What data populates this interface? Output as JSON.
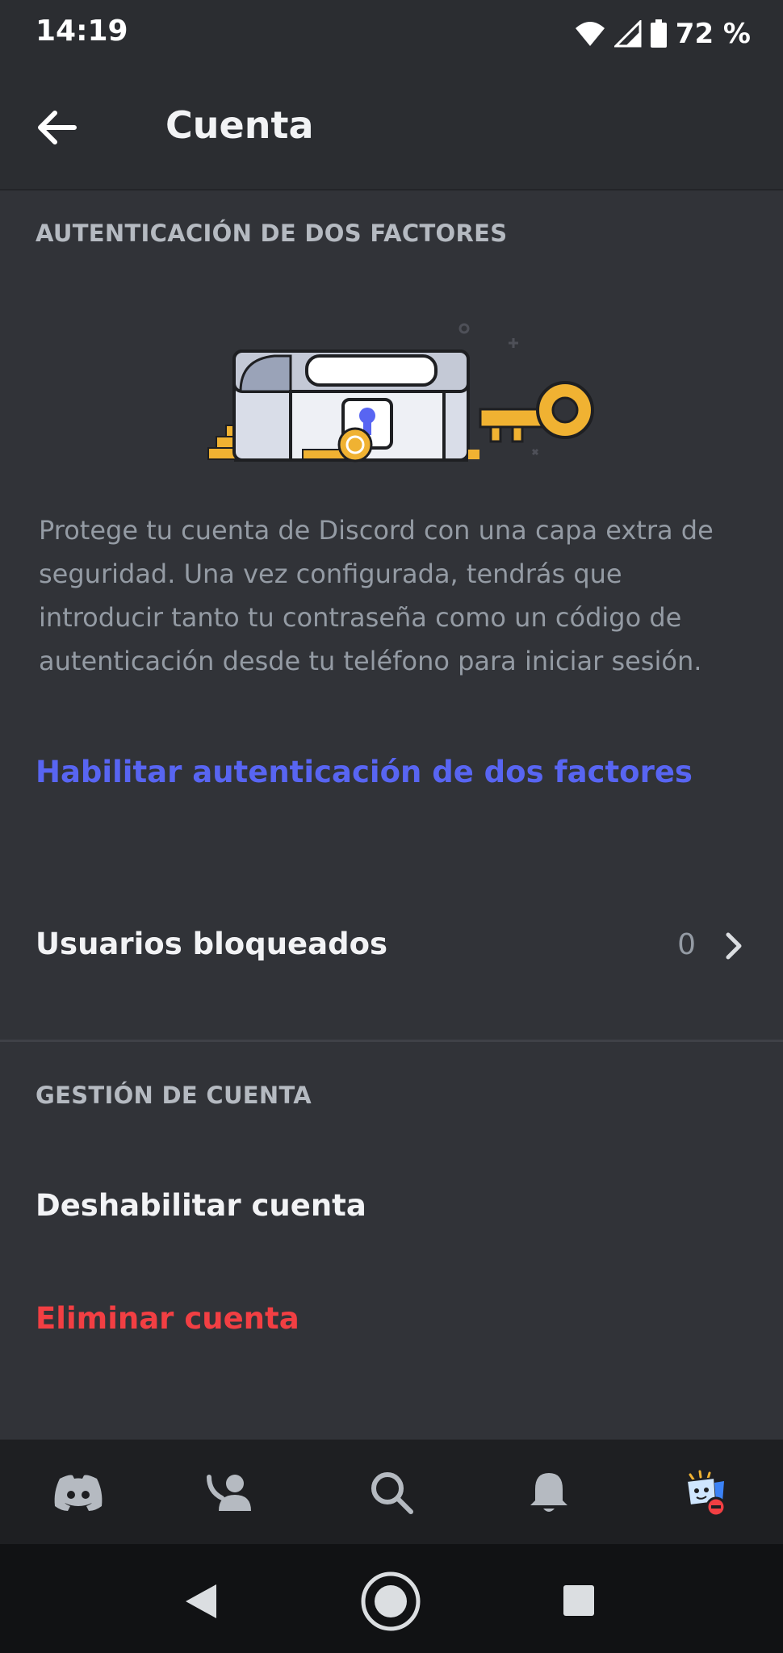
{
  "status_bar": {
    "time": "14:19",
    "battery": "72 %",
    "icons": [
      "wifi-icon",
      "signal-icon",
      "battery-icon"
    ]
  },
  "header": {
    "title": "Cuenta",
    "back_icon": "arrow-left-icon"
  },
  "two_factor": {
    "section_title": "AUTENTICACIÓN DE DOS FACTORES",
    "illustration": "treasure-chest-key-illustration",
    "description": "Protege tu cuenta de Discord con una capa extra de seguridad. Una vez configurada, tendrás que introducir tanto tu contraseña como un código de autenticación desde tu teléfono para iniciar sesión.",
    "enable_link": "Habilitar autenticación de dos factores"
  },
  "blocked_users": {
    "label": "Usuarios bloqueados",
    "count": "0",
    "chevron_icon": "chevron-right-icon"
  },
  "account_management": {
    "section_title": "GESTIÓN DE CUENTA",
    "disable_label": "Deshabilitar cuenta",
    "delete_label": "Eliminar cuenta"
  },
  "bottom_nav": {
    "items": [
      "discord-home-icon",
      "friends-icon",
      "search-icon",
      "notifications-bell-icon",
      "profile-avatar-icon"
    ]
  },
  "system_nav": [
    "back-triangle-icon",
    "home-circle-icon",
    "recents-square-icon"
  ],
  "colors": {
    "background": "#313338",
    "header": "#2b2d31",
    "link": "#5865f2",
    "danger": "#f23f43",
    "muted": "#949ba4",
    "nav": "#1e1f22"
  }
}
